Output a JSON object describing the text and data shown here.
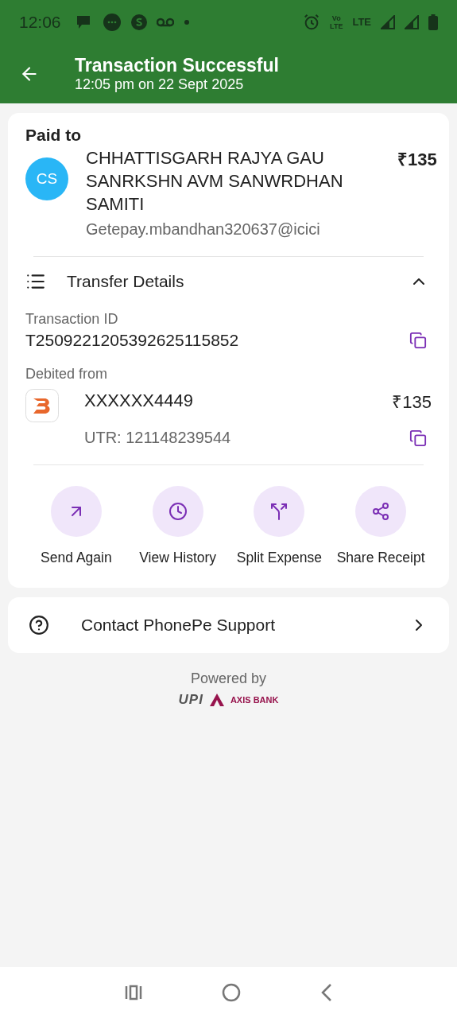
{
  "status_bar": {
    "time": "12:06",
    "volte": [
      "Vo",
      "LTE"
    ],
    "network": "LTE"
  },
  "header": {
    "title": "Transaction Successful",
    "subtitle": "12:05 pm on 22 Sept 2025"
  },
  "payment": {
    "label": "Paid to",
    "initials": "CS",
    "payee": "CHHATTISGARH RAJYA GAU SANRKSHN AVM SANWRDHAN SAMITI",
    "amount": "₹135",
    "upi_id": "Getepay.mbandhan320637@icici"
  },
  "transfer_details": {
    "title": "Transfer Details",
    "expanded": true,
    "transaction_id_label": "Transaction ID",
    "transaction_id": "T2509221205392625115852",
    "debited_label": "Debited from",
    "account": "XXXXXX4449",
    "debit_amount": "₹135",
    "utr": "UTR: 121148239544"
  },
  "actions": [
    {
      "kind": "send",
      "label": "Send Again"
    },
    {
      "kind": "history",
      "label": "View History"
    },
    {
      "kind": "split",
      "label": "Split Expense"
    },
    {
      "kind": "share",
      "label": "Share Receipt"
    }
  ],
  "support": {
    "label": "Contact PhonePe Support"
  },
  "footer": {
    "powered_by": "Powered by",
    "upi": "UPI",
    "bank": "AXIS BANK"
  }
}
